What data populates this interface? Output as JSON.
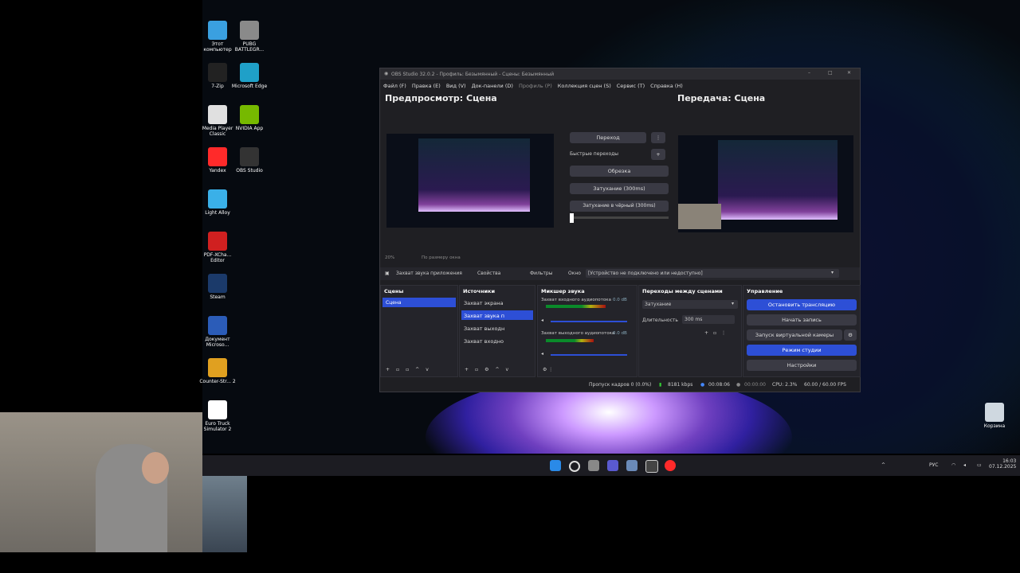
{
  "desktop": {
    "icons": [
      {
        "label": "Этот компьютер",
        "icon": "computer-icon",
        "color": "#3aa0e0"
      },
      {
        "label": "PUBG BATTLEGR...",
        "icon": "pubg-icon",
        "color": "#8a8a8a"
      },
      {
        "label": "7-Zip",
        "icon": "7zip-icon",
        "color": "#222222"
      },
      {
        "label": "Microsoft Edge",
        "icon": "edge-icon",
        "color": "#1fa0c8"
      },
      {
        "label": "Media Player Classic",
        "icon": "mpc-icon",
        "color": "#e0e0e0"
      },
      {
        "label": "NVIDIA App",
        "icon": "nvidia-icon",
        "color": "#76b900"
      },
      {
        "label": "Yandex",
        "icon": "yandex-icon",
        "color": "#ff2a2a"
      },
      {
        "label": "OBS Studio",
        "icon": "obs-icon",
        "color": "#333333"
      },
      {
        "label": "Light Alloy",
        "icon": "lightalloy-icon",
        "color": "#3ab0e8"
      },
      {
        "label": "PDF-XCha... Editor",
        "icon": "pdf-icon",
        "color": "#d02020"
      },
      {
        "label": "Steam",
        "icon": "steam-icon",
        "color": "#1b3a6a"
      },
      {
        "label": "Документ Microso...",
        "icon": "word-icon",
        "color": "#2b5cb8"
      },
      {
        "label": "Counter-Str... 2",
        "icon": "cs2-icon",
        "color": "#e0a020"
      },
      {
        "label": "Euro Truck Simulator 2",
        "icon": "file-icon",
        "color": "#ffffff"
      }
    ],
    "recycle_bin": "Корзина"
  },
  "taskbar": {
    "lang": "РУС",
    "time": "16:03",
    "date": "07.12.2025"
  },
  "obs": {
    "title": "OBS Studio 32.0.2 - Профиль: Безымянный - Сцены: Безымянный",
    "menu": [
      "Файл (F)",
      "Правка (E)",
      "Вид (V)",
      "Док-панели (D)",
      "Профиль (P)",
      "Коллекция сцен (S)",
      "Сервис (T)",
      "Справка (H)"
    ],
    "preview_title": "Предпросмотр: Сцена",
    "program_title": "Передача: Сцена",
    "zoom": "20%",
    "fit_label": "По размеру окна",
    "transition_btn": "Переход",
    "quick_transitions": "Быстрые переходы",
    "quick_items": [
      "Обрезка",
      "Затухание (300ms)",
      "Затухание в чёрный (300ms)"
    ],
    "source_toolbar": {
      "source_name": "Захват звука приложения",
      "properties": "Свойства",
      "filters": "Фильтры",
      "window_label": "Окно",
      "window_value": "[Устройство не подключено или недоступно]"
    },
    "docks": {
      "scenes": {
        "title": "Сцены",
        "items": [
          "Сцена"
        ]
      },
      "sources": {
        "title": "Источники",
        "items": [
          "Захват экрана",
          "Захват звука п",
          "Захват выходн",
          "Захват входно"
        ]
      },
      "mixer": {
        "title": "Микшер звука",
        "channels": [
          {
            "name": "Захват входного аудиопотока",
            "db": "0.0 dB",
            "level": 0.75
          },
          {
            "name": "Захват выходного аудиопотока",
            "db": "0.0 dB",
            "level": 0.6
          }
        ]
      },
      "transitions": {
        "title": "Переходы между сценами",
        "selected": "Затухание",
        "duration_label": "Длительность",
        "duration_value": "300 ms"
      },
      "controls": {
        "title": "Управление",
        "buttons": [
          "Остановить трансляцию",
          "Начать запись",
          "Запуск виртуальной камеры",
          "Режим студии",
          "Настройки"
        ]
      }
    },
    "status": {
      "dropped": "Пропуск кадров 0 (0.0%)",
      "bitrate": "8181 kbps",
      "stream_time": "00:08:06",
      "rec_time": "00:00:00",
      "cpu": "CPU: 2.3%",
      "fps": "60.00 / 60.00 FPS"
    }
  }
}
